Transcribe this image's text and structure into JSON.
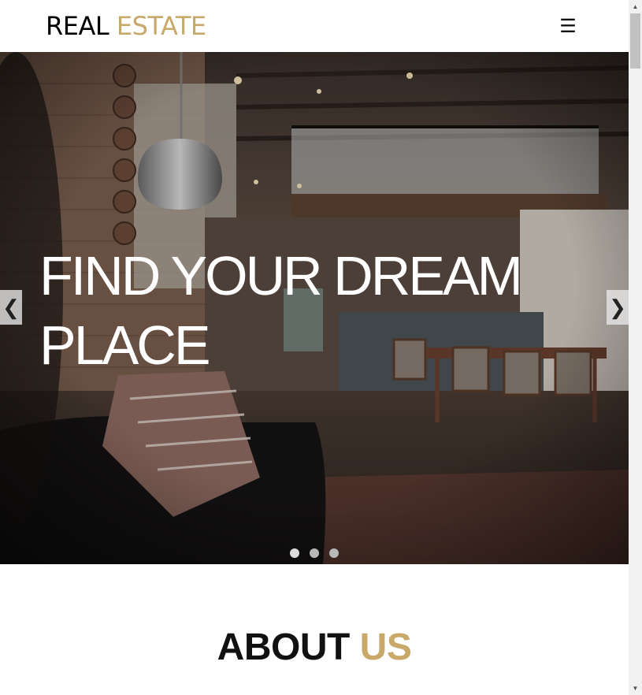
{
  "header": {
    "logo_word1": "REAL",
    "logo_word2": "ESTATE",
    "menu_icon": "☰"
  },
  "hero": {
    "title": "FIND YOUR DREAM PLACE",
    "prev_glyph": "❮",
    "next_glyph": "❯",
    "slide_count": 3,
    "active_slide": 1
  },
  "about": {
    "title_word1": "ABOUT",
    "title_word2": "US"
  },
  "scrollbar": {
    "up_glyph": "▲",
    "down_glyph": "▼"
  },
  "colors": {
    "accent": "#c8a96a",
    "text": "#111111",
    "hero_overlay": "#2a2624"
  },
  "icons": {
    "menu": "hamburger-menu-icon",
    "prev": "chevron-left-icon",
    "next": "chevron-right-icon"
  }
}
